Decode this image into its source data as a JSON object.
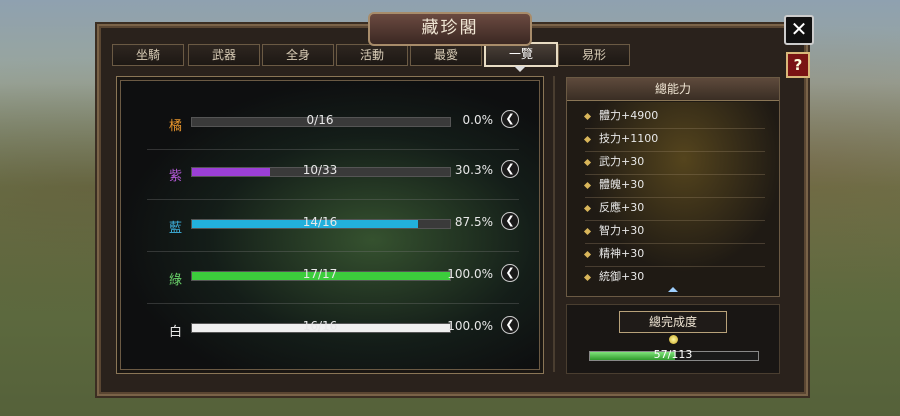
{
  "window": {
    "title": "藏珍閣",
    "close_icon": "✕",
    "help_icon": "?"
  },
  "tabs": [
    {
      "label": "坐騎"
    },
    {
      "label": "武器"
    },
    {
      "label": "全身"
    },
    {
      "label": "活動"
    },
    {
      "label": "最愛"
    },
    {
      "label": "一覽",
      "active": true
    },
    {
      "label": "易形"
    }
  ],
  "collection": [
    {
      "grade": "橘",
      "color": "#e8952c",
      "count": "0/16",
      "percent": "0.0%",
      "progress": 0.0,
      "bar_color": "#9a9a9a"
    },
    {
      "grade": "紫",
      "color": "#b45ad8",
      "count": "10/33",
      "percent": "30.3%",
      "progress": 0.303,
      "bar_color": "#9b3fd6"
    },
    {
      "grade": "藍",
      "color": "#3fb3e0",
      "count": "14/16",
      "percent": "87.5%",
      "progress": 0.875,
      "bar_color": "#22b0dc"
    },
    {
      "grade": "綠",
      "color": "#6bd46b",
      "count": "17/17",
      "percent": "100.0%",
      "progress": 1.0,
      "bar_color": "#3ccc3c"
    },
    {
      "grade": "白",
      "color": "#e8e8e8",
      "count": "16/16",
      "percent": "100.0%",
      "progress": 1.0,
      "bar_color": "#f0f0f0"
    }
  ],
  "stats": {
    "header": "總能力",
    "items": [
      "體力+4900",
      "技力+1100",
      "武力+30",
      "體魄+30",
      "反應+30",
      "智力+30",
      "精神+30",
      "統御+30"
    ]
  },
  "completion": {
    "label": "總完成度",
    "value": "57/113",
    "progress": 0.504
  }
}
